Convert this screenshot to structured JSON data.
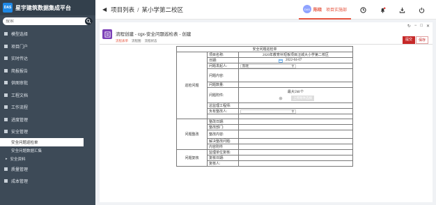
{
  "app": {
    "logo_text": "DAS",
    "title": "星宇建筑数据集成平台"
  },
  "search": {
    "placeholder": "搜索"
  },
  "sidebar": {
    "items": [
      {
        "label": "模型选择"
      },
      {
        "label": "项目门户"
      },
      {
        "label": "实时传达"
      },
      {
        "label": "简报报告"
      },
      {
        "label": "供图审批"
      },
      {
        "label": "工程文档"
      },
      {
        "label": "工作流程"
      },
      {
        "label": "进度管理"
      },
      {
        "label": "安全管理"
      }
    ],
    "sub_items": [
      {
        "label": "安全问题巡检单"
      },
      {
        "label": "安全问题数据汇集"
      },
      {
        "label": "安全资料"
      }
    ],
    "items_after": [
      {
        "label": "质量管理"
      },
      {
        "label": "成本管理"
      }
    ]
  },
  "breadcrumb": {
    "root": "项目列表",
    "current": "某小学第二校区"
  },
  "user": {
    "avatar_text": "DAS",
    "name": "陈晓",
    "project_badge": "项目实施部"
  },
  "form": {
    "title": "流程创建 - cgx-安全问题巡检表 - 创建",
    "tabs": [
      "流程表单",
      "流程图",
      "流程状态"
    ],
    "submit_label": "提交",
    "save_label": "保存"
  },
  "table": {
    "caption": "安全问题巡检单",
    "group_inspect": "巡检问题",
    "group_rectify": "问题整改",
    "group_review": "问题复核",
    "rows": {
      "project_name": {
        "label": "项目名称:",
        "value": "2020年教育补短板项目汪城大小学第二校区"
      },
      "date": {
        "label": "日期:",
        "value": "2022-04-07"
      },
      "initiator": {
        "label": "问题发起人:",
        "value": "陈晓"
      },
      "content": {
        "label": "问题内容:"
      },
      "count": {
        "label": "问题数量:"
      },
      "attachment": {
        "label": "问题附件:",
        "max_size": "最大5M/个",
        "upload_label": "上传附件选择"
      },
      "engineer": {
        "label": "总监理工程师:"
      },
      "owner": {
        "label": "负有整改人:"
      }
    },
    "rect_rows": [
      "整改日期:",
      "整改部门:",
      "整改内容:",
      "解决整改问题:",
      "内容附件"
    ],
    "review_rows": [
      "监理单位复核:",
      "复核日期:",
      "复核人:"
    ]
  }
}
